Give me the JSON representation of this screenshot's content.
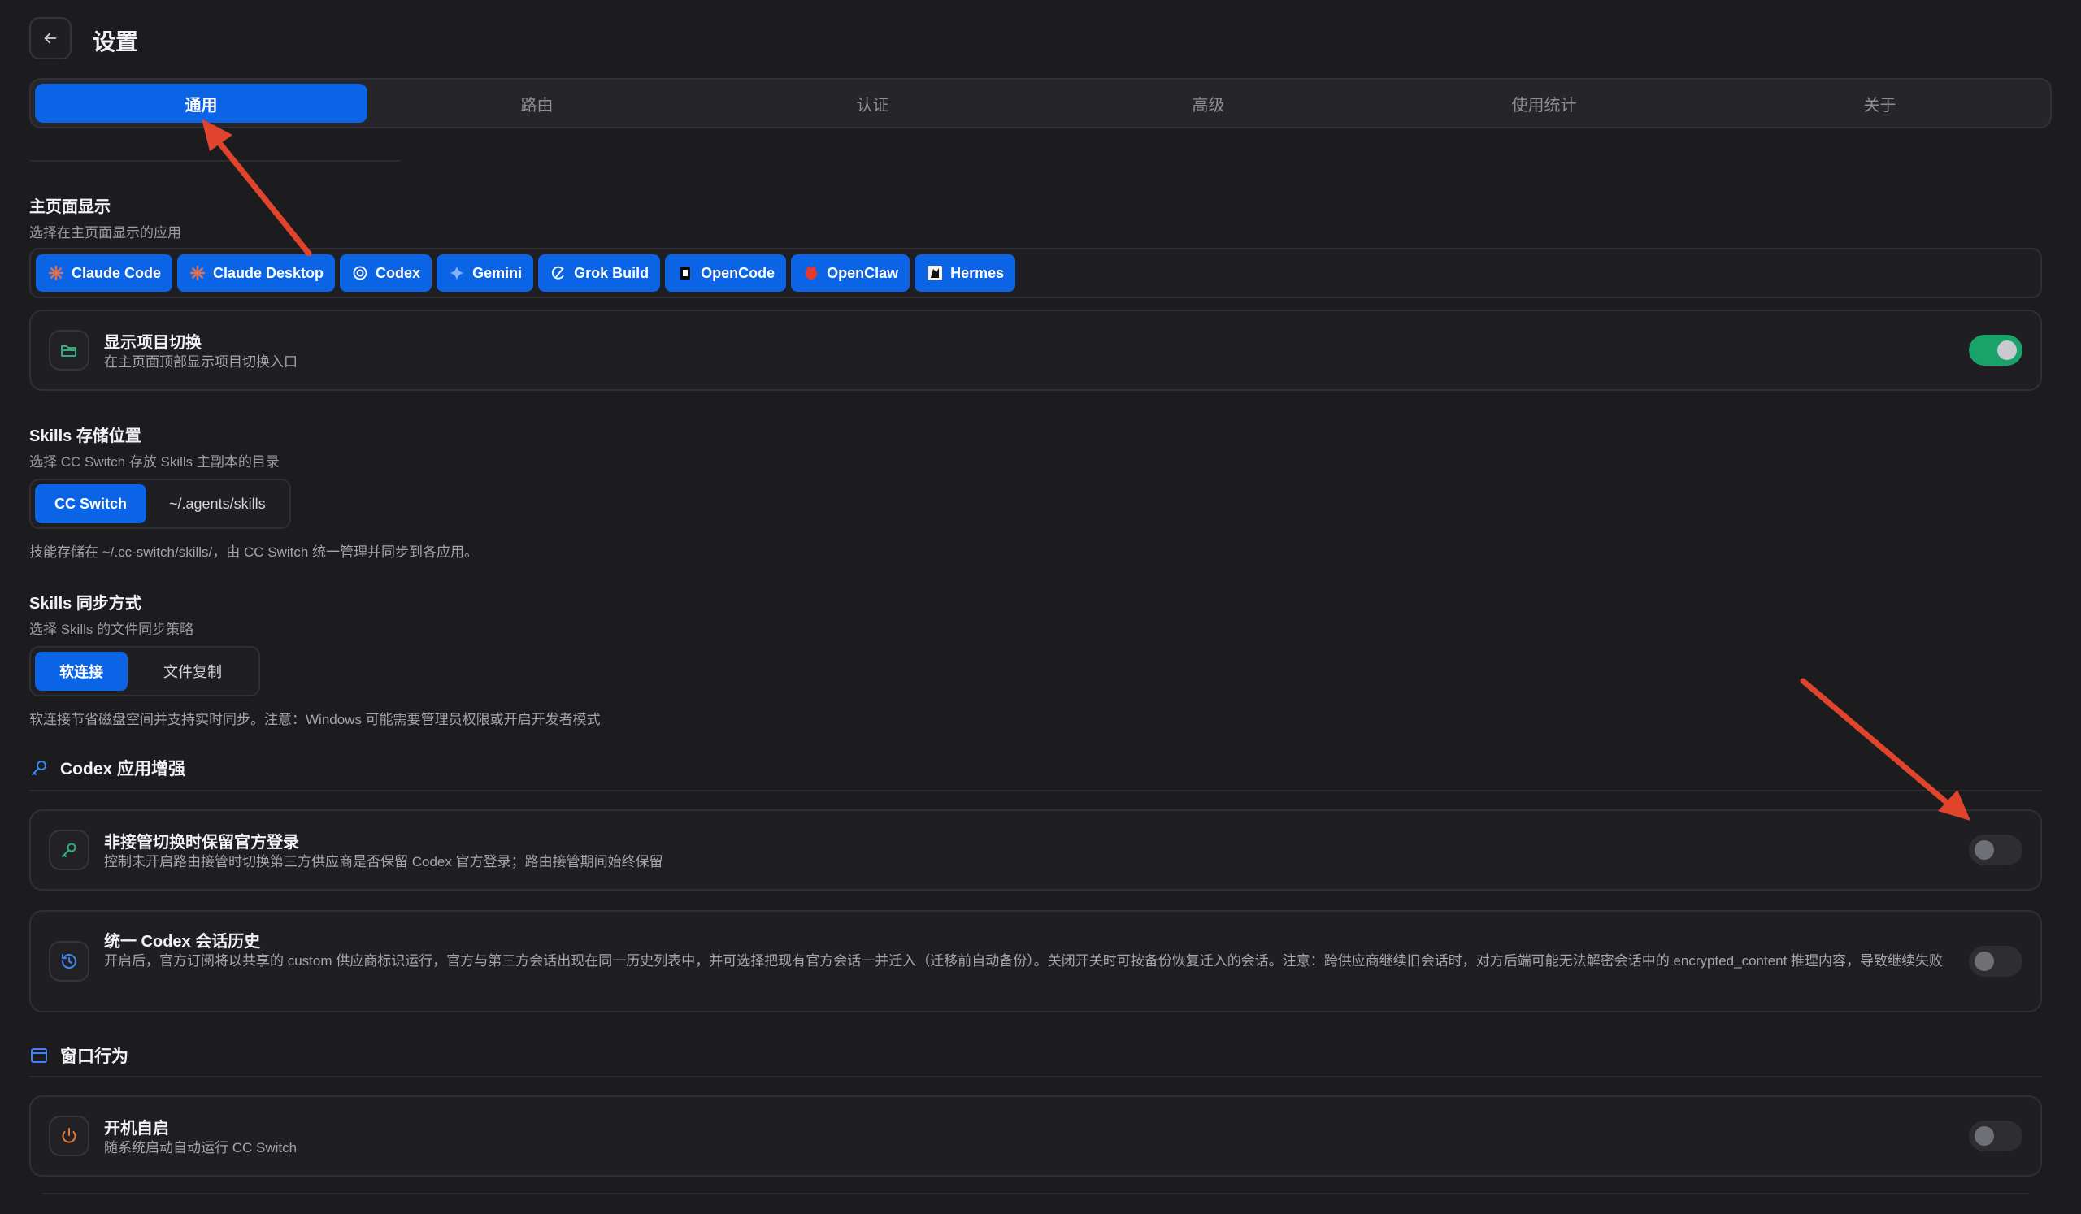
{
  "header": {
    "title": "设置"
  },
  "tabs": [
    {
      "label": "通用",
      "active": true
    },
    {
      "label": "路由",
      "active": false
    },
    {
      "label": "认证",
      "active": false
    },
    {
      "label": "高级",
      "active": false
    },
    {
      "label": "使用统计",
      "active": false
    },
    {
      "label": "关于",
      "active": false
    }
  ],
  "home_display": {
    "title": "主页面显示",
    "subtitle": "选择在主页面显示的应用",
    "apps": [
      {
        "label": "Claude Code",
        "icon": "claude-icon"
      },
      {
        "label": "Claude Desktop",
        "icon": "claude-icon"
      },
      {
        "label": "Codex",
        "icon": "openai-icon"
      },
      {
        "label": "Gemini",
        "icon": "gemini-icon"
      },
      {
        "label": "Grok Build",
        "icon": "grok-icon"
      },
      {
        "label": "OpenCode",
        "icon": "opencode-icon"
      },
      {
        "label": "OpenClaw",
        "icon": "openclaw-icon"
      },
      {
        "label": "Hermes",
        "icon": "hermes-icon"
      }
    ]
  },
  "project_switch": {
    "title": "显示项目切换",
    "desc": "在主页面顶部显示项目切换入口",
    "enabled": true
  },
  "skills_storage": {
    "title": "Skills 存储位置",
    "subtitle": "选择 CC Switch 存放 Skills 主副本的目录",
    "options": [
      "CC Switch",
      "~/.agents/skills"
    ],
    "selected": "CC Switch",
    "note": "技能存储在 ~/.cc-switch/skills/，由 CC Switch 统一管理并同步到各应用。"
  },
  "skills_sync": {
    "title": "Skills 同步方式",
    "subtitle": "选择 Skills 的文件同步策略",
    "options": [
      "软连接",
      "文件复制"
    ],
    "selected": "软连接",
    "note": "软连接节省磁盘空间并支持实时同步。注意：Windows 可能需要管理员权限或开启开发者模式"
  },
  "codex_group": {
    "title": "Codex 应用增强",
    "keep_login": {
      "title": "非接管切换时保留官方登录",
      "desc": "控制未开启路由接管时切换第三方供应商是否保留 Codex 官方登录；路由接管期间始终保留",
      "enabled": false
    },
    "unify_history": {
      "title": "统一 Codex 会话历史",
      "desc": "开启后，官方订阅将以共享的 custom 供应商标识运行，官方与第三方会话出现在同一历史列表中，并可选择把现有官方会话一并迁入（迁移前自动备份）。关闭开关时可按备份恢复迁入的会话。注意：跨供应商继续旧会话时，对方后端可能无法解密会话中的 encrypted_content 推理内容，导致继续失败",
      "enabled": false
    }
  },
  "window_group": {
    "title": "窗口行为",
    "autostart": {
      "title": "开机自启",
      "desc": "随系统启动自动运行 CC Switch",
      "enabled": false
    }
  },
  "colors": {
    "accent": "#0b63e5",
    "toggle_on": "#19a36b",
    "annotation_arrow": "#e0442c"
  }
}
